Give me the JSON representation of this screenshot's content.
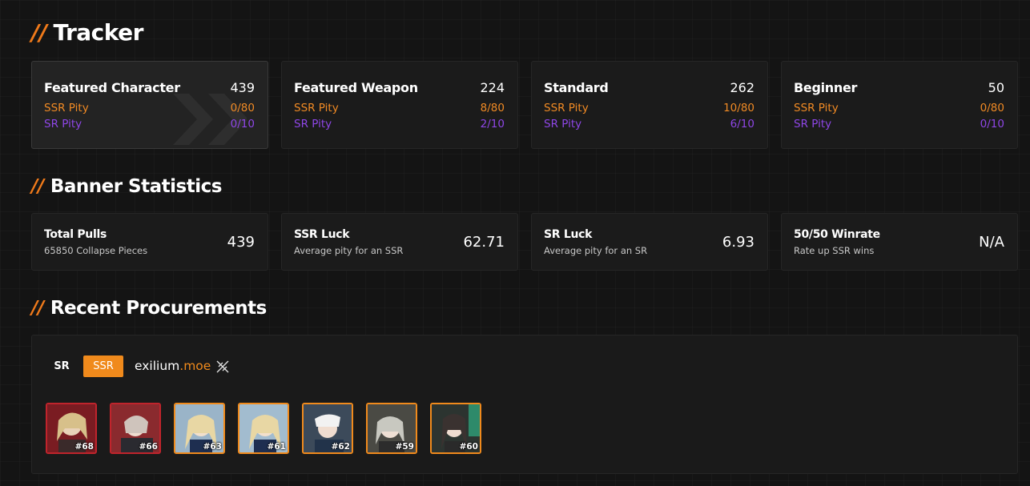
{
  "tracker": {
    "prefix": "//",
    "title": "Tracker",
    "banners": [
      {
        "name": "Featured Character",
        "total": "439",
        "ssr_label": "SSR Pity",
        "ssr_value": "0/80",
        "sr_label": "SR Pity",
        "sr_value": "0/10",
        "active": true
      },
      {
        "name": "Featured Weapon",
        "total": "224",
        "ssr_label": "SSR Pity",
        "ssr_value": "8/80",
        "sr_label": "SR Pity",
        "sr_value": "2/10",
        "active": false
      },
      {
        "name": "Standard",
        "total": "262",
        "ssr_label": "SSR Pity",
        "ssr_value": "10/80",
        "sr_label": "SR Pity",
        "sr_value": "6/10",
        "active": false
      },
      {
        "name": "Beginner",
        "total": "50",
        "ssr_label": "SSR Pity",
        "ssr_value": "0/80",
        "sr_label": "SR Pity",
        "sr_value": "0/10",
        "active": false
      }
    ]
  },
  "stats": {
    "prefix": "//",
    "title": "Banner Statistics",
    "items": [
      {
        "label": "Total Pulls",
        "sub": "65850 Collapse Pieces",
        "value": "439"
      },
      {
        "label": "SSR Luck",
        "sub": "Average pity for an SSR",
        "value": "62.71"
      },
      {
        "label": "SR Luck",
        "sub": "Average pity for an SR",
        "value": "6.93"
      },
      {
        "label": "50/50 Winrate",
        "sub": "Rate up SSR wins",
        "value": "N/A"
      }
    ]
  },
  "recent": {
    "prefix": "//",
    "title": "Recent Procurements",
    "tabs": {
      "sr": "SR",
      "ssr": "SSR"
    },
    "brand": {
      "name": "exilium",
      "tld": ".moe"
    },
    "pulls": [
      {
        "badge": "#68",
        "rarity": "red"
      },
      {
        "badge": "#66",
        "rarity": "red"
      },
      {
        "badge": "#63",
        "rarity": "orange"
      },
      {
        "badge": "#61",
        "rarity": "orange"
      },
      {
        "badge": "#62",
        "rarity": "orange"
      },
      {
        "badge": "#59",
        "rarity": "orange"
      },
      {
        "badge": "#60",
        "rarity": "orange"
      }
    ]
  },
  "colors": {
    "accent": "#f08a1c",
    "ssr": "#f08a24",
    "sr": "#8e46e6",
    "red": "#c0242c"
  }
}
